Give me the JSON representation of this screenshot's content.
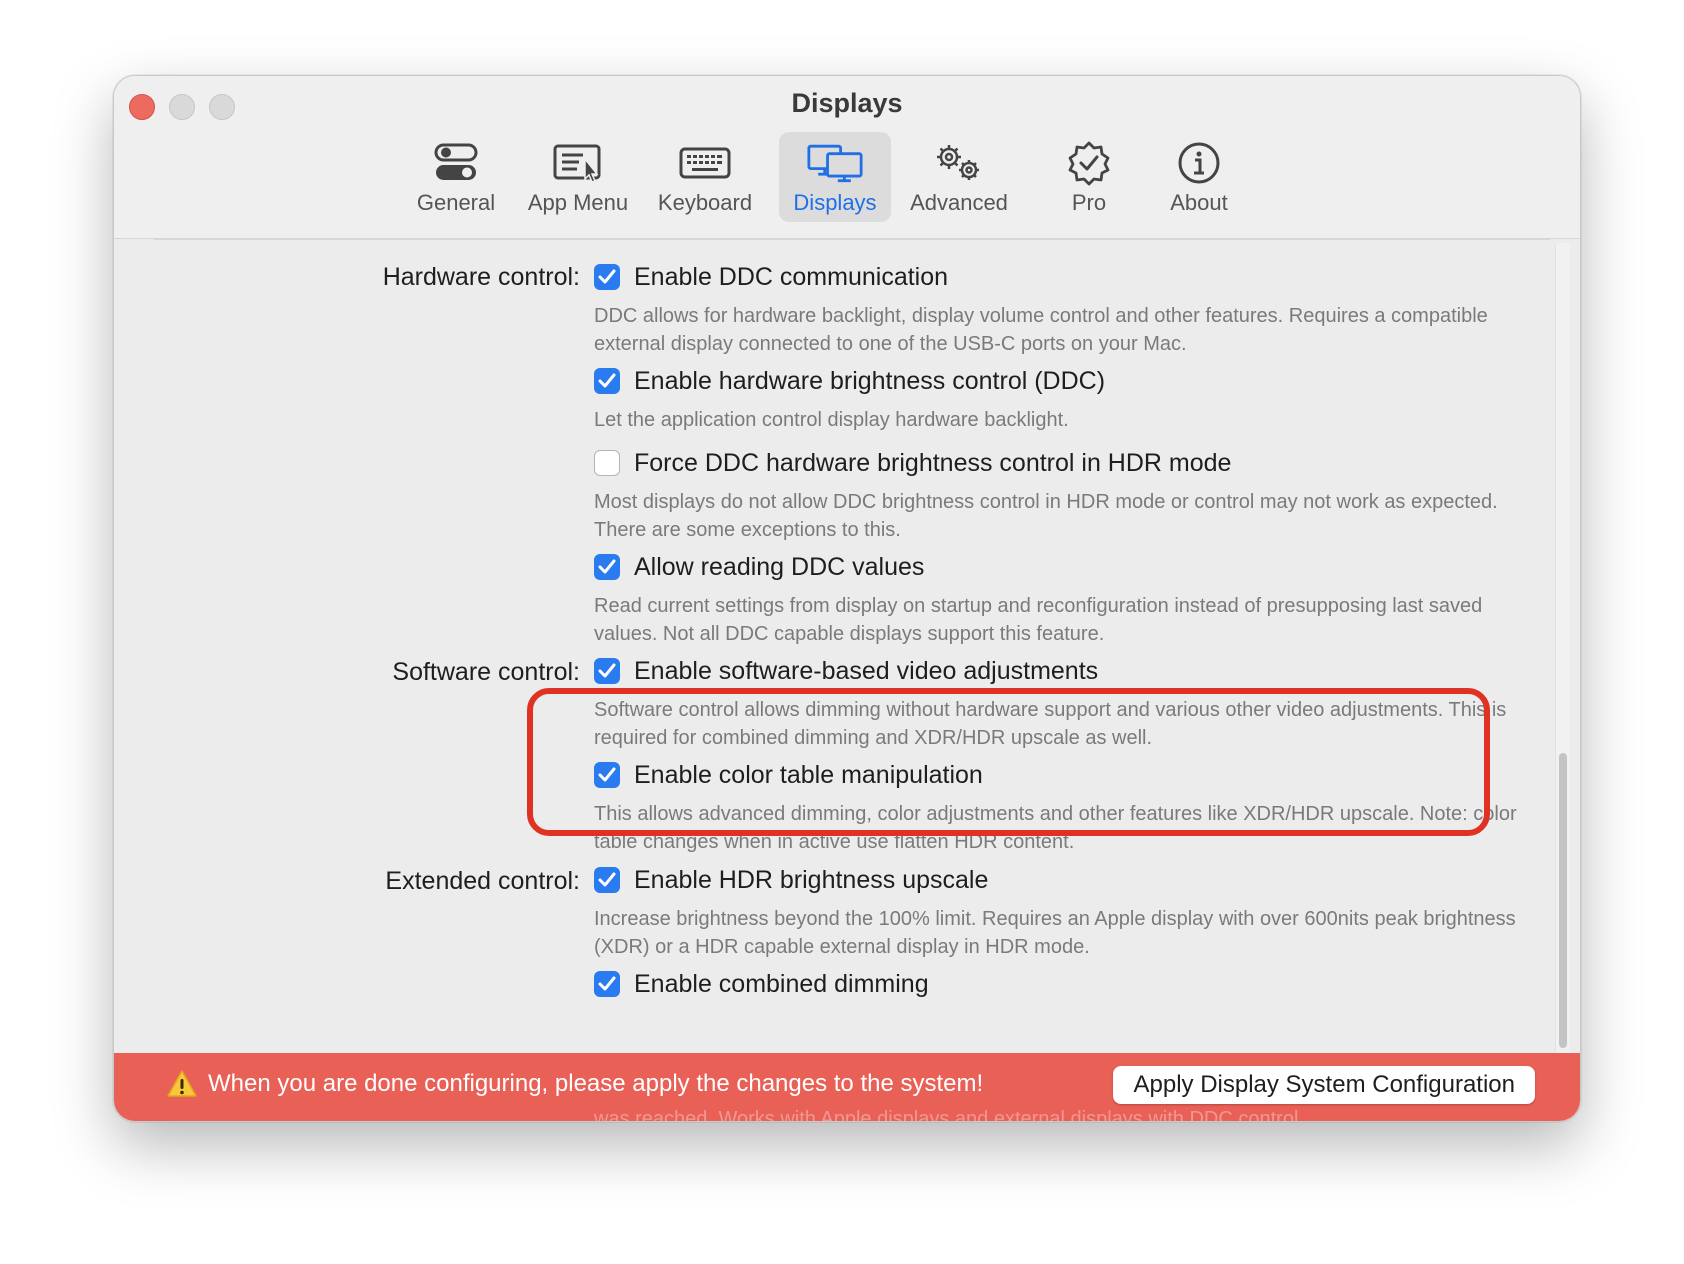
{
  "window": {
    "title": "Displays"
  },
  "toolbar": {
    "tabs": [
      {
        "label": "General",
        "icon": "toggle-icon"
      },
      {
        "label": "App Menu",
        "icon": "app-menu-icon"
      },
      {
        "label": "Keyboard",
        "icon": "keyboard-icon"
      },
      {
        "label": "Displays",
        "icon": "displays-icon",
        "selected": true
      },
      {
        "label": "Advanced",
        "icon": "gears-icon"
      },
      {
        "label": "Pro",
        "icon": "badge-check-icon"
      },
      {
        "label": "About",
        "icon": "info-icon"
      }
    ]
  },
  "sections": {
    "hardware": "Hardware control:",
    "software": "Software control:",
    "extended": "Extended control:"
  },
  "options": [
    {
      "label": "Enable DDC communication",
      "checked": true,
      "description": "DDC allows for hardware backlight, display volume control and other features. Requires a compatible external display connected to one of the USB-C ports on your Mac."
    },
    {
      "label": "Enable hardware brightness control (DDC)",
      "checked": true,
      "description": "Let the application control display hardware backlight."
    },
    {
      "label": "Force DDC hardware brightness control in HDR mode",
      "checked": false,
      "description": "Most displays do not allow DDC brightness control in HDR mode or control may not work as expected. There are some exceptions to this."
    },
    {
      "label": "Allow reading DDC values",
      "checked": true,
      "description": "Read current settings from display on startup and reconfiguration instead of presupposing last saved values. Not all DDC capable displays support this feature."
    },
    {
      "label": "Enable software-based video adjustments",
      "checked": true,
      "description": "Software control allows dimming without hardware support and  various other video adjustments. This is required for combined dimming and XDR/HDR upscale as well."
    },
    {
      "label": "Enable color table manipulation",
      "checked": true,
      "description": "This allows advanced dimming, color adjustments and other features like XDR/HDR upscale. Note: color table changes when in active use flatten HDR content."
    },
    {
      "label": "Enable HDR brightness upscale",
      "checked": true,
      "description": "Increase brightness beyond the 100% limit. Requires an Apple display with over 600nits peak brightness (XDR) or a HDR capable external display in HDR mode."
    },
    {
      "label": "Enable combined dimming",
      "checked": true,
      "description": "was reached. Works with Apple displays and external displays with DDC control."
    }
  ],
  "banner": {
    "message": "When you are done configuring, please apply the changes to the system!",
    "button": "Apply Display System Configuration",
    "color": "#e8544a"
  },
  "accent": "#2a7bf0",
  "highlight_color": "#e03223"
}
